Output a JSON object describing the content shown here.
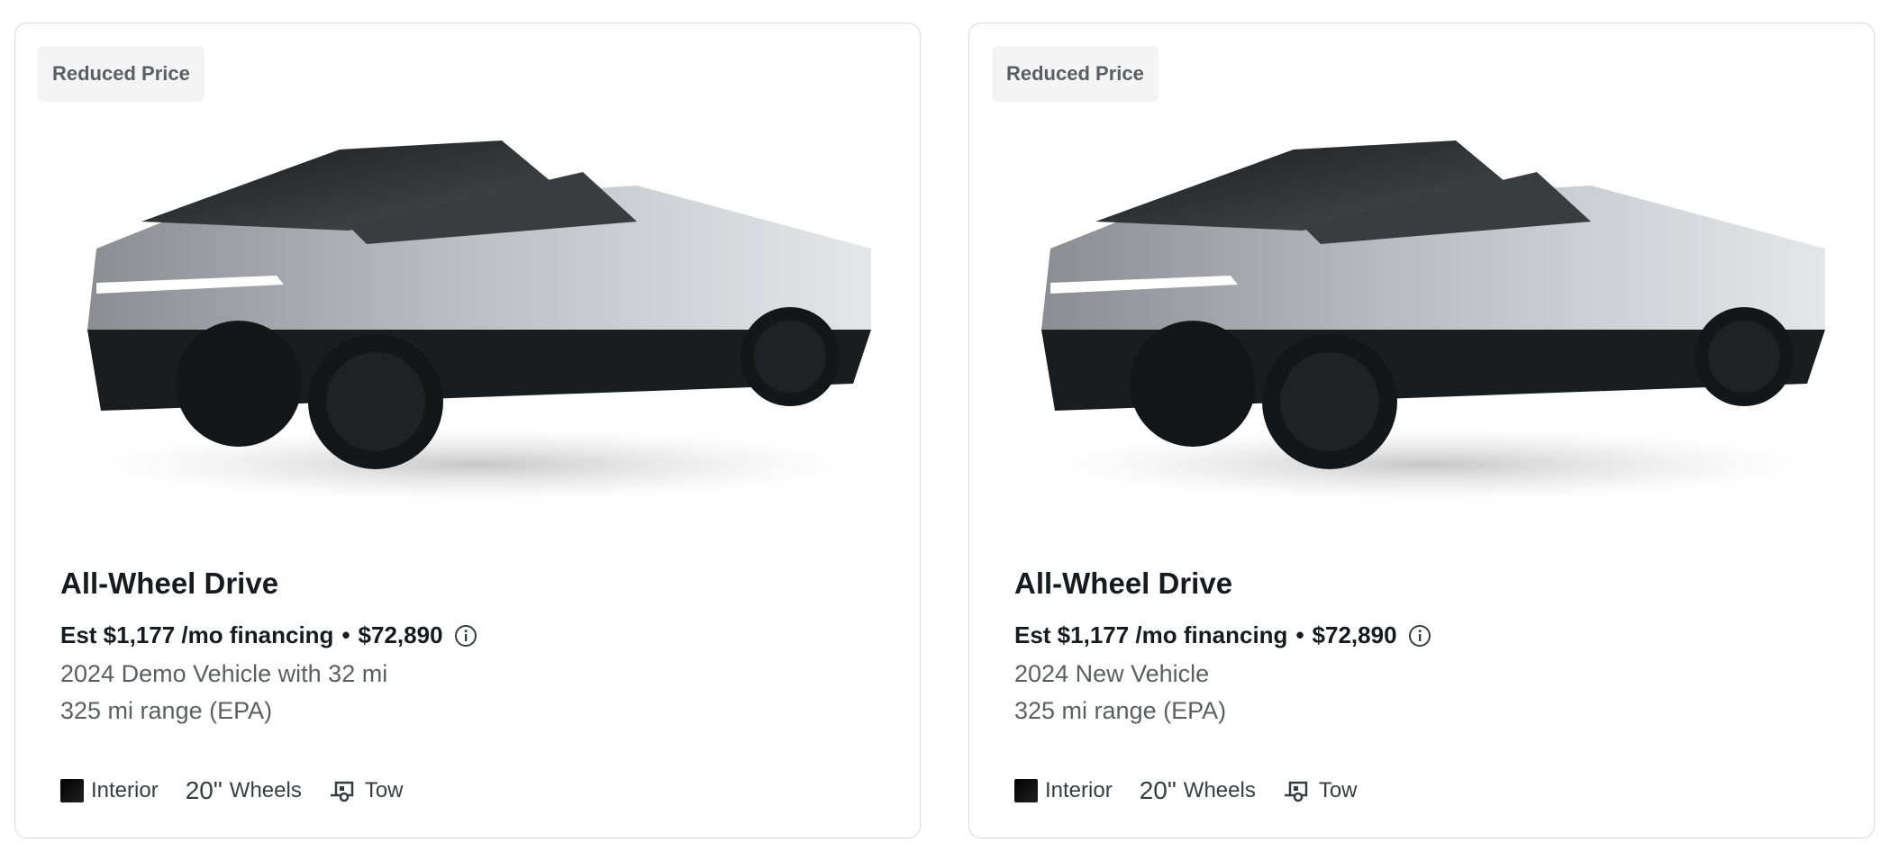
{
  "listings": [
    {
      "badge": "Reduced Price",
      "image_icon": "cybertruck-image",
      "title": "All-Wheel Drive",
      "financing": "Est $1,177 /mo financing",
      "separator": "•",
      "price": "$72,890",
      "detail": "2024 Demo Vehicle with 32 mi",
      "range": "325 mi range (EPA)",
      "features": {
        "interior": "Interior",
        "wheels_size": "20\"",
        "wheels": "Wheels",
        "tow": "Tow"
      }
    },
    {
      "badge": "Reduced Price",
      "image_icon": "cybertruck-image",
      "title": "All-Wheel Drive",
      "financing": "Est $1,177 /mo financing",
      "separator": "•",
      "price": "$72,890",
      "detail": "2024 New Vehicle",
      "range": "325 mi range (EPA)",
      "features": {
        "interior": "Interior",
        "wheels_size": "20\"",
        "wheels": "Wheels",
        "tow": "Tow"
      }
    }
  ],
  "colors": {
    "text_primary": "#171a20",
    "text_secondary": "#5c5e62",
    "badge_bg": "#f4f4f4",
    "border": "#d9d9dc"
  }
}
